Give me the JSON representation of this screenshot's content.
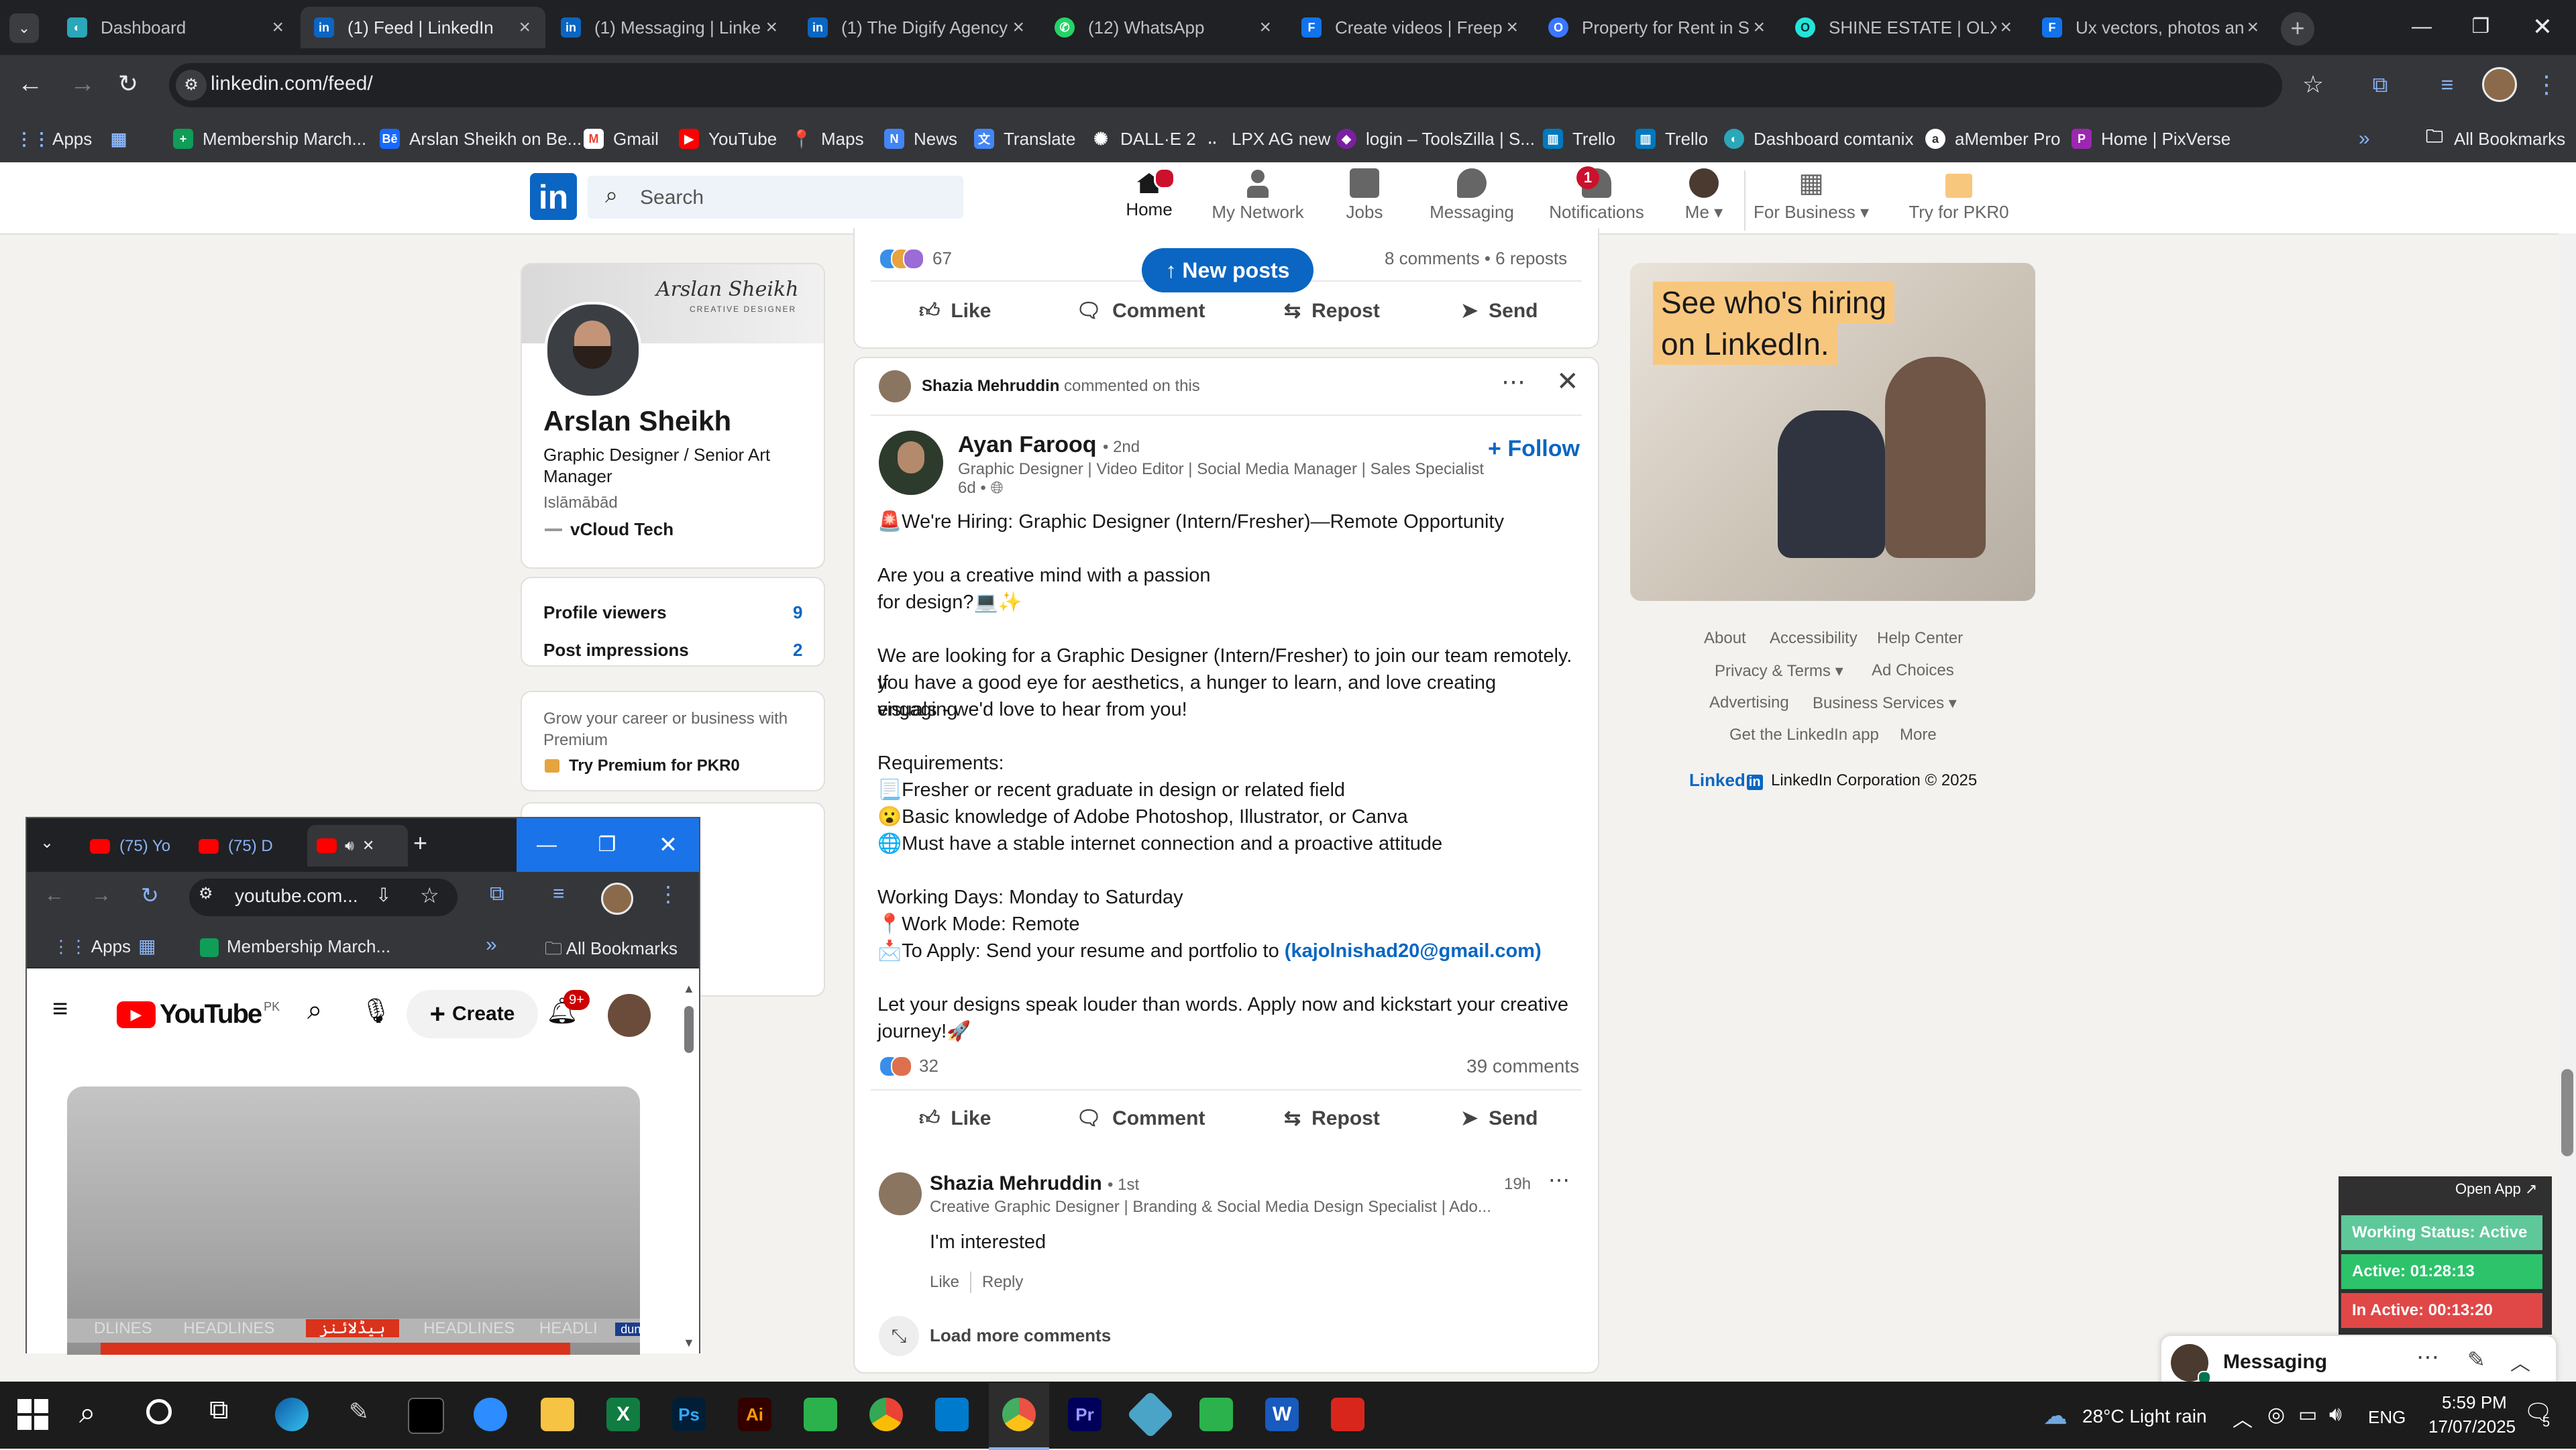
{
  "browser": {
    "tabs": [
      {
        "title": "Dashboard",
        "color": "#2aa7b8"
      },
      {
        "title": "(1) Feed | LinkedIn",
        "color": "#0a66c2"
      },
      {
        "title": "(1) Messaging | Linke",
        "color": "#0a66c2"
      },
      {
        "title": "(1) The Digify Agency",
        "color": "#0a66c2"
      },
      {
        "title": "(12) WhatsApp",
        "color": "#25d366"
      },
      {
        "title": "Create videos | Freep",
        "color": "#1273eb"
      },
      {
        "title": "Property for Rent in S",
        "color": "#3a77ff"
      },
      {
        "title": "SHINE ESTATE | OLX",
        "color": "#23e5db"
      },
      {
        "title": "Ux vectors, photos an",
        "color": "#1273eb"
      }
    ],
    "active_tab": "(1) Feed | LinkedIn",
    "url": "linkedin.com/feed/",
    "bookmarks": [
      "Apps",
      "Membership March...",
      "Arslan Sheikh on Be...",
      "Gmail",
      "YouTube",
      "Maps",
      "News",
      "Translate",
      "DALL·E 2",
      "LPX AG new",
      "login – ToolsZilla | S...",
      "Trello",
      "Trello",
      "Dashboard comtanix",
      "aMember Pro",
      "Home | PixVerse"
    ],
    "all_bookmarks": "All Bookmarks"
  },
  "linkedin": {
    "search_placeholder": "Search",
    "nav": {
      "home": "Home",
      "my_network": "My Network",
      "jobs": "Jobs",
      "messaging": "Messaging",
      "notifications": "Notifications",
      "me": "Me",
      "for_business": "For Business",
      "try_premium": "Try for PKR0"
    },
    "nav_badges": {
      "home": "",
      "notifications": "1"
    },
    "profile": {
      "name": "Arslan Sheikh",
      "headline": "Graphic Designer / Senior Art Manager",
      "location": "Islāmābād",
      "company": "vCloud Tech",
      "banner_text": "Arslan Sheikh",
      "banner_sub": "CREATIVE DESIGNER",
      "profile_viewers_label": "Profile viewers",
      "profile_viewers_count": "9",
      "post_impressions_label": "Post impressions",
      "post_impressions_count": "2",
      "premium_text": "Grow your career or business with Premium",
      "premium_link": "Try Premium for PKR0"
    },
    "feed": {
      "prev_post": {
        "reactions_count": "67",
        "stats": "8 comments • 6 reposts",
        "new_posts": "New posts"
      },
      "actions": {
        "like": "Like",
        "comment": "Comment",
        "repost": "Repost",
        "send": "Send"
      },
      "post": {
        "context_name": "Shazia Mehruddin",
        "context_text": "commented on this",
        "author_name": "Ayan Farooq",
        "author_degree": "• 2nd",
        "author_headline": "Graphic Designer | Video Editor | Social Media Manager | Sales Specialist",
        "time": "6d •",
        "follow": "Follow",
        "lines": [
          "🚨We're Hiring: Graphic Designer (Intern/Fresher)—Remote Opportunity",
          "",
          "Are you a creative mind with a passion",
          "for design?💻✨",
          "",
          "We are looking for a Graphic Designer (Intern/Fresher) to join our team remotely. If",
          "you have a good eye for aesthetics, a hunger to learn, and love creating engaging",
          "visuals - we'd love to hear from you!",
          "",
          "Requirements:",
          "📃Fresher or recent graduate in design or related field",
          "😮Basic knowledge of Adobe Photoshop, Illustrator, or Canva",
          "🌐Must have a stable internet connection and a proactive attitude",
          "",
          "Working Days: Monday to Saturday",
          "📍Work Mode: Remote",
          "📩To Apply: Send your resume and portfolio to ",
          "",
          "Let your designs speak louder than words. Apply now and kickstart your creative",
          "journey!🚀"
        ],
        "email": "(kajolnishad20@gmail.com)",
        "reactions_count": "32",
        "comments_count": "39 comments"
      },
      "comment": {
        "name": "Shazia Mehruddin",
        "degree": "• 1st",
        "headline": "Creative Graphic Designer | Branding & Social Media Design Specialist | Ado...",
        "time": "19h",
        "text": "I'm interested",
        "like": "Like",
        "reply": "Reply",
        "load_more": "Load more comments"
      }
    },
    "ad": {
      "line1": "See who's hiring",
      "line2": "on LinkedIn."
    },
    "footer": {
      "links": [
        "About",
        "Accessibility",
        "Help Center",
        "Privacy & Terms",
        "Ad Choices",
        "Advertising",
        "Business Services",
        "Get the LinkedIn app",
        "More"
      ],
      "brand": "Linked",
      "copyright": "LinkedIn Corporation © 2025"
    },
    "messaging_label": "Messaging"
  },
  "popup_window": {
    "tabs": [
      "(75) Yo",
      "(75) D",
      ""
    ],
    "url": "youtube.com...",
    "bookmarks": [
      "Apps",
      "Membership March..."
    ],
    "all_bookmarks": "All Bookmarks",
    "yt_logo": "YouTube",
    "yt_region": "PK",
    "create": "Create",
    "notif_badge": "9+",
    "video_banner": [
      "DLINES",
      "HEADLINES",
      "ہیڈلائنز",
      "HEADLINES",
      "HEADLI",
      "dunya"
    ]
  },
  "tracker": {
    "open_app": "Open App ↗",
    "working_status": "Working Status: Active",
    "active": "Active: 01:28:13",
    "inactive": "In Active: 00:13:20"
  },
  "taskbar": {
    "weather": "28°C  Light rain",
    "lang": "ENG",
    "time": "5:59 PM",
    "date": "17/07/2025",
    "notif_count": "5"
  }
}
